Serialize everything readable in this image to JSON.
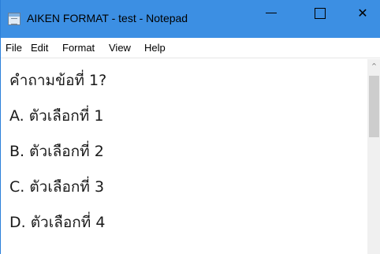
{
  "window": {
    "title": "AIKEN FORMAT - test - Notepad",
    "accent_color": "#3c8fe3",
    "icon": "notepad-icon",
    "controls": {
      "minimize_icon": "minimize-icon",
      "maximize_icon": "maximize-icon",
      "close_glyph": "✕"
    }
  },
  "menu": {
    "items": [
      "File",
      "Edit",
      "Format",
      "View",
      "Help"
    ]
  },
  "editor": {
    "lines": [
      "คำถามข้อที่ 1?",
      "A. ตัวเลือกที่ 1",
      "B. ตัวเลือกที่ 2",
      "C. ตัวเลือกที่ 3",
      "D. ตัวเลือกที่ 4"
    ]
  },
  "scrollbar": {
    "up_glyph": "^"
  }
}
